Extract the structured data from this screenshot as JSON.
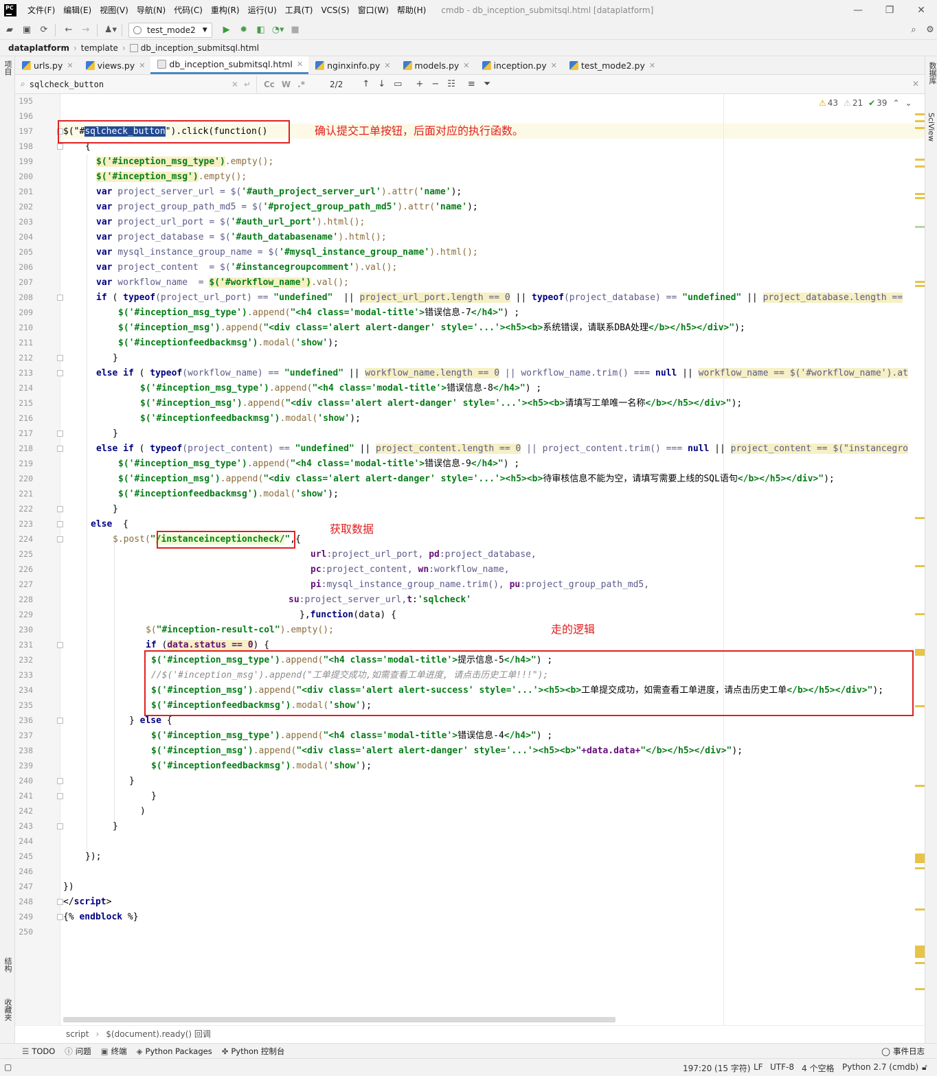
{
  "app": {
    "logo": "PC",
    "window_title": "cmdb - db_inception_submitsql.html [dataplatform]",
    "menu": [
      "文件(F)",
      "编辑(E)",
      "视图(V)",
      "导航(N)",
      "代码(C)",
      "重构(R)",
      "运行(U)",
      "工具(T)",
      "VCS(S)",
      "窗口(W)",
      "帮助(H)"
    ]
  },
  "toolbar": {
    "run_config": "test_mode2"
  },
  "breadcrumb": {
    "project": "dataplatform",
    "folder": "template",
    "file": "db_inception_submitsql.html"
  },
  "left_strip": {
    "project": "项目",
    "structure": "结构",
    "favorites": "收藏夹"
  },
  "right_strip": {
    "database": "数据库",
    "sciview": "SciView"
  },
  "tabs": [
    {
      "label": "urls.py",
      "type": "py"
    },
    {
      "label": "views.py",
      "type": "py"
    },
    {
      "label": "db_inception_submitsql.html",
      "type": "html",
      "active": true
    },
    {
      "label": "nginxinfo.py",
      "type": "py"
    },
    {
      "label": "models.py",
      "type": "py"
    },
    {
      "label": "inception.py",
      "type": "py"
    },
    {
      "label": "test_mode2.py",
      "type": "py"
    }
  ],
  "search": {
    "query": "sqlcheck_button",
    "opt_case": "Cc",
    "opt_word": "W",
    "opt_regex": ".*",
    "count": "2/2"
  },
  "inspections": {
    "warnings": "43",
    "weak_warnings": "21",
    "typos": "39"
  },
  "annotations": {
    "confirm_button": "确认提交工单按钮，后面对应的执行函数。",
    "fetch_data": "获取数据",
    "logic": "走的逻辑"
  },
  "code_lines": [
    "195",
    "196",
    "197",
    "198",
    "199",
    "200",
    "201",
    "202",
    "203",
    "204",
    "205",
    "206",
    "207",
    "208",
    "209",
    "210",
    "211",
    "212",
    "213",
    "214",
    "215",
    "216",
    "217",
    "218",
    "219",
    "220",
    "221",
    "222",
    "223",
    "224",
    "225",
    "226",
    "227",
    "228",
    "229",
    "230",
    "231",
    "232",
    "233",
    "234",
    "235",
    "236",
    "237",
    "238",
    "239",
    "240",
    "241",
    "242",
    "243",
    "244",
    "245",
    "246",
    "247",
    "248",
    "249",
    "250"
  ],
  "code": {
    "c197_a": "$(\"#",
    "c197_b": "sqlcheck_button",
    "c197_c": "\").click(function()",
    "c198": "{",
    "c199_a": "$('#inception_msg_type')",
    "c199_b": ".empty();",
    "c200_a": "$('#inception_msg')",
    "c200_b": ".empty();",
    "c201_a": "var",
    "c201_b": " project_server_url = $(",
    "c201_c": "'#auth_project_server_url'",
    "c201_d": ").attr(",
    "c201_e": "'name'",
    "c201_f": ");",
    "c202_a": "var",
    "c202_b": " project_group_path_md5 = $(",
    "c202_c": "'#project_group_path_md5'",
    "c202_d": ").attr(",
    "c202_e": "'name'",
    "c202_f": ");",
    "c203_a": "var",
    "c203_b": " project_url_port = $(",
    "c203_c": "'#auth_url_port'",
    "c203_d": ").html();",
    "c204_a": "var",
    "c204_b": " project_database = $(",
    "c204_c": "'#auth_databasename'",
    "c204_d": ").html();",
    "c205_a": "var",
    "c205_b": " mysql_instance_group_name = $(",
    "c205_c": "'#mysql_instance_group_name'",
    "c205_d": ").html();",
    "c206_a": "var",
    "c206_b": " project_content  = $(",
    "c206_c": "'#instancegroupcomment'",
    "c206_d": ").val();",
    "c207_a": "var",
    "c207_b": " workflow_name  = ",
    "c207_c": "$('#workflow_name')",
    "c207_d": ".val();",
    "c208_a": "if",
    "c208_b": " ( ",
    "c208_c": "typeof",
    "c208_d": "(project_url_port) == ",
    "c208_e": "\"undefined\"",
    "c208_f": "  || ",
    "c208_g": "project_url_port.length == 0",
    "c208_h": " || ",
    "c208_i": "typeof",
    "c208_j": "(project_database) == ",
    "c208_k": "\"undefined\"",
    "c208_l": " || ",
    "c208_m": "project_database.length ==",
    "c209_a": "$('#inception_msg_type')",
    "c209_b": ".append(",
    "c209_c": "\"<h4 class='modal-title'>",
    "c209_d": "错误信息-7",
    "c209_e": "</h4>\"",
    "c209_f": ") ;",
    "c210_a": "$('#inception_msg')",
    "c210_b": ".append(",
    "c210_c": "\"<div class='alert alert-danger' style='...'><h5><b>",
    "c210_d": "系统错误，请联系DBA处理",
    "c210_e": "</b></h5></div>\"",
    "c210_f": ");",
    "c211_a": "$('#inceptionfeedbackmsg')",
    "c211_b": ".modal(",
    "c211_c": "'show'",
    "c211_d": ");",
    "c212": "}",
    "c213_a": "else if",
    "c213_b": " ( ",
    "c213_c": "typeof",
    "c213_d": "(workflow_name) == ",
    "c213_e": "\"undefined\"",
    "c213_f": " || ",
    "c213_g": "workflow_name.length == 0",
    "c213_h": " || workflow_name.trim() === ",
    "c213_i": "null",
    "c213_j": " || ",
    "c213_k": "workflow_name == $('#workflow_name').at",
    "c214_a": "$('#inception_msg_type')",
    "c214_b": ".append(",
    "c214_c": "\"<h4 class='modal-title'>",
    "c214_d": "错误信息-8",
    "c214_e": "</h4>\"",
    "c214_f": ") ;",
    "c215_a": "$('#inception_msg')",
    "c215_b": ".append(",
    "c215_c": "\"<div class='alert alert-danger' style='...'><h5><b>",
    "c215_d": "请填写工单唯一名称",
    "c215_e": "</b></h5></div>\"",
    "c215_f": ");",
    "c216_a": "$('#inceptionfeedbackmsg')",
    "c216_b": ".modal(",
    "c216_c": "'show'",
    "c216_d": ");",
    "c217": "}",
    "c218_a": "else if",
    "c218_b": " ( ",
    "c218_c": "typeof",
    "c218_d": "(project_content) == ",
    "c218_e": "\"undefined\"",
    "c218_f": " || ",
    "c218_g": "project_content.length == 0",
    "c218_h": " || project_content.trim() === ",
    "c218_i": "null",
    "c218_j": " || ",
    "c218_k": "project_content == $(\"instancegro",
    "c219_a": "$('#inception_msg_type')",
    "c219_b": ".append(",
    "c219_c": "\"<h4 class='modal-title'>",
    "c219_d": "错误信息-9",
    "c219_e": "</h4>\"",
    "c219_f": ") ;",
    "c220_a": "$('#inception_msg')",
    "c220_b": ".append(",
    "c220_c": "\"<div class='alert alert-danger' style='...'><h5><b>",
    "c220_d": "待审核信息不能为空，请填写需要上线的SQL语句",
    "c220_e": "</b></h5></div>\"",
    "c220_f": ");",
    "c221_a": "$('#inceptionfeedbackmsg')",
    "c221_b": ".modal(",
    "c221_c": "'show'",
    "c221_d": ");",
    "c222": "}",
    "c223_a": "else",
    "c223_b": "  {",
    "c224_a": "$.post(",
    "c224_b": "\"",
    "c224_c": "/instanceinceptioncheck/",
    "c224_d": "\"",
    "c224_e": ",{",
    "c225_a": "url",
    "c225_b": ":project_url_port, ",
    "c225_c": "pd",
    "c225_d": ":project_database,",
    "c226_a": "pc",
    "c226_b": ":project_content, ",
    "c226_c": "wn",
    "c226_d": ":workflow_name,",
    "c227_a": "pi",
    "c227_b": ":mysql_instance_group_name.trim(), ",
    "c227_c": "pu",
    "c227_d": ":project_group_path_md5,",
    "c228_a": "su",
    "c228_b": ":project_server_url,",
    "c228_c": "t",
    "c228_d": ":",
    "c228_e": "'sqlcheck'",
    "c229_a": "},",
    "c229_b": "function",
    "c229_c": "(data) {",
    "c230_a": "$(",
    "c230_b": "\"#inception-result-col\"",
    "c230_c": ").empty();",
    "c231_a": "if",
    "c231_b": " (",
    "c231_c": "data.status == 0",
    "c231_d": ") {",
    "c232_a": "$('#inception_msg_type')",
    "c232_b": ".append(",
    "c232_c": "\"<h4 class='modal-title'>",
    "c232_d": "提示信息-5",
    "c232_e": "</h4>\"",
    "c232_f": ") ;",
    "c233": "//$('#inception_msg').append(\"工单提交成功,如需查看工单进度, 请点击历史工单!!!\");",
    "c234_a": "$('#inception_msg')",
    "c234_b": ".append(",
    "c234_c": "\"<div class='alert alert-success' style='...'><h5><b>",
    "c234_d": "工单提交成功，如需查看工单进度，请点击历史工单",
    "c234_e": "</b></h5></div>\"",
    "c234_f": ");",
    "c235_a": "$('#inceptionfeedbackmsg')",
    "c235_b": ".modal(",
    "c235_c": "'show'",
    "c235_d": ");",
    "c236_a": "} ",
    "c236_b": "else",
    "c236_c": " {",
    "c237_a": "$('#inception_msg_type')",
    "c237_b": ".append(",
    "c237_c": "\"<h4 class='modal-title'>",
    "c237_d": "错误信息-4",
    "c237_e": "</h4>\"",
    "c237_f": ") ;",
    "c238_a": "$('#inception_msg')",
    "c238_b": ".append(",
    "c238_c": "\"<div class='alert alert-danger' style='...'><h5><b>\"",
    "c238_d": "+data.data+",
    "c238_e": "\"</b></h5></div>\"",
    "c238_f": ");",
    "c239_a": "$('#inceptionfeedbackmsg')",
    "c239_b": ".modal(",
    "c239_c": "'show'",
    "c239_d": ");",
    "c240": "}",
    "c241": "}",
    "c242": ")",
    "c243": "}",
    "c245": "});",
    "c247": "})",
    "c248_a": "</",
    "c248_b": "script",
    "c248_c": ">",
    "c249_a": "{% ",
    "c249_b": "endblock",
    "c249_c": " %}"
  },
  "bottom_crumbs": {
    "a": "script",
    "b": "$(document).ready() 回调"
  },
  "tool_windows": [
    "TODO",
    "问题",
    "终端",
    "Python Packages",
    "Python 控制台"
  ],
  "event_log": "事件日志",
  "status": {
    "position": "197:20 (15 字符)",
    "line_sep": "LF",
    "encoding": "UTF-8",
    "indent": "4 个空格",
    "interpreter": "Python 2.7 (cmdb)"
  }
}
